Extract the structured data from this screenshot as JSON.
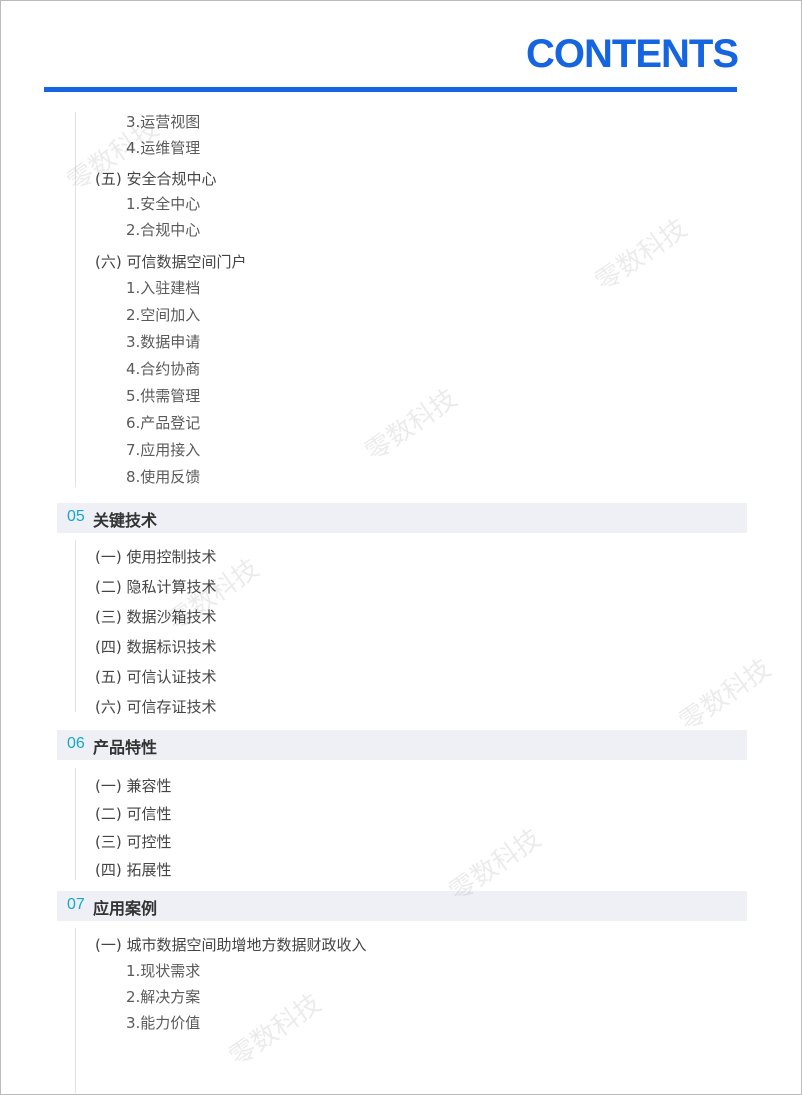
{
  "header": {
    "title": "CONTENTS"
  },
  "watermark": "零数科技",
  "continued": {
    "items_a": [
      "3.运营视图",
      "4.运维管理"
    ],
    "sub5": {
      "label": "(五) 安全合规中心",
      "items": [
        "1.安全中心",
        "2.合规中心"
      ]
    },
    "sub6": {
      "label": "(六) 可信数据空间门户",
      "items": [
        "1.入驻建档",
        "2.空间加入",
        "3.数据申请",
        "4.合约协商",
        "5.供需管理",
        "6.产品登记",
        "7.应用接入",
        "8.使用反馈"
      ]
    }
  },
  "sections": [
    {
      "num": "05",
      "title": "关键技术",
      "subs": [
        "(一) 使用控制技术",
        "(二) 隐私计算技术",
        "(三) 数据沙箱技术",
        "(四) 数据标识技术",
        "(五) 可信认证技术",
        "(六) 可信存证技术"
      ]
    },
    {
      "num": "06",
      "title": "产品特性",
      "subs": [
        "(一) 兼容性",
        "(二) 可信性",
        "(三) 可控性",
        "(四) 拓展性"
      ]
    },
    {
      "num": "07",
      "title": "应用案例",
      "subs": [
        "(一) 城市数据空间助增地方数据财政收入"
      ],
      "items": [
        "1.现状需求",
        "2.解决方案",
        "3.能力价值"
      ]
    }
  ]
}
